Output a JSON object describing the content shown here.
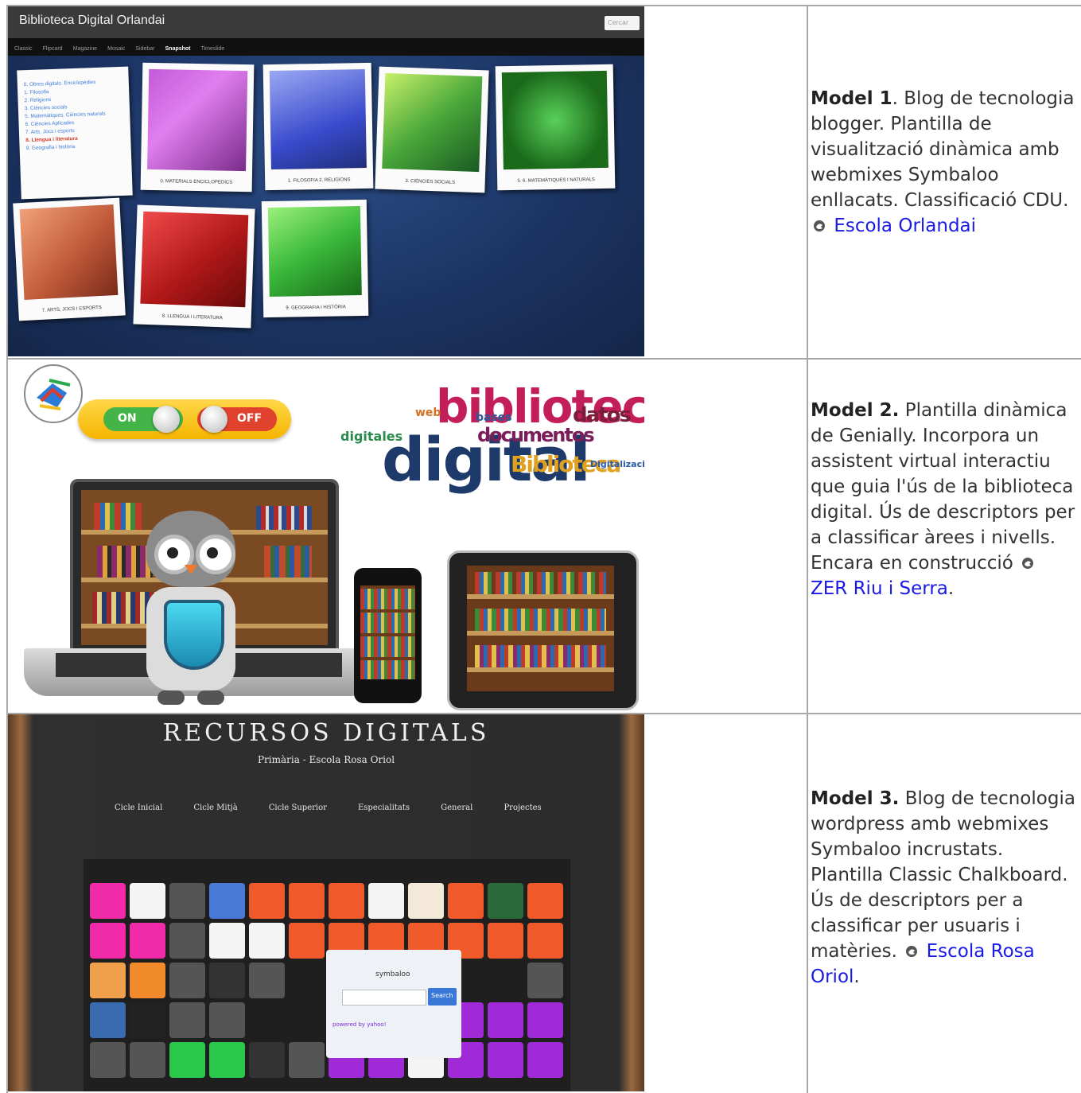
{
  "rows": [
    {
      "model_label": "Model 1",
      "description_after_label": ". Blog de tecnologia blogger. Plantilla de visualització dinàmica amb webmixes Symbaloo enllacats. Classificació CDU.",
      "link_text": "Escola Orlandai",
      "trailing": "",
      "screenshot": {
        "blog_title": "Biblioteca Digital Orlandai",
        "search_placeholder": "Cercar",
        "nav_items": [
          "Classic",
          "Flipcard",
          "Magazine",
          "Mosaic",
          "Sidebar",
          "Snapshot",
          "Timeslide"
        ],
        "nav_active": "Snapshot",
        "cdu_list": [
          "0. Obres digitals. Enciclopèdies",
          "1. Filosofia",
          "2. Religions",
          "3. Ciències socials",
          "5. Matemàtiques. Ciències naturals",
          "6. Ciències Aplicades",
          "7. Arts. Jocs i esports",
          "8. Llengua i literatura",
          "9. Geografia i història"
        ],
        "captions": [
          "0. MATERIALS ENCICLOPEDICS",
          "1. FILOSOFIA 2. RELIGIONS",
          "3. CIÈNCIES SOCIALS",
          "5. 6. MATEMÀTIQUES I NATURALS",
          "7. ARTS, JOCS I ESPORTS",
          "8. LLENGUA I LITERATURA",
          "9. GEOGRAFIA I HISTÒRIA"
        ]
      }
    },
    {
      "model_label": "Model 2.",
      "description_after_label": " Plantilla dinàmica de Genially. Incorpora un assistent virtual interactiu que guia l'ús de la biblioteca digital. Ús de descriptors per a classificar àrees i nivells. Encara en construcció",
      "link_text": "ZER Riu i Serra",
      "trailing": ".",
      "screenshot": {
        "toggle_on": "ON",
        "toggle_off": "OFF",
        "cloud_words": [
          "biblioteca",
          "digital",
          "documentos",
          "datos",
          "Biblioteca",
          "digitales",
          "bases",
          "Digitalización",
          "web"
        ]
      }
    },
    {
      "model_label": "Model 3.",
      "description_after_label": " Blog de tecnologia wordpress amb webmixes Symbaloo incrustats. Plantilla Classic Chalkboard. Ús de descriptors per a classificar per usuaris i matèries.",
      "link_text": "Escola Rosa Oriol",
      "trailing": ".",
      "screenshot": {
        "title": "RECURSOS DIGITALS",
        "subtitle": "Primària - Escola Rosa Oriol",
        "menu": [
          "Cicle Inicial",
          "Cicle Mitjà",
          "Cicle Superior",
          "Especialitats",
          "General",
          "Projectes"
        ],
        "symbaloo_logo": "symbaloo",
        "search_button": "Search",
        "powered_by": "powered by yahoo!"
      }
    }
  ],
  "colors": {
    "link": "#1a1ae6",
    "border": "#a8a8a8",
    "text": "#333333"
  },
  "icons": [
    "external-link-icon"
  ]
}
